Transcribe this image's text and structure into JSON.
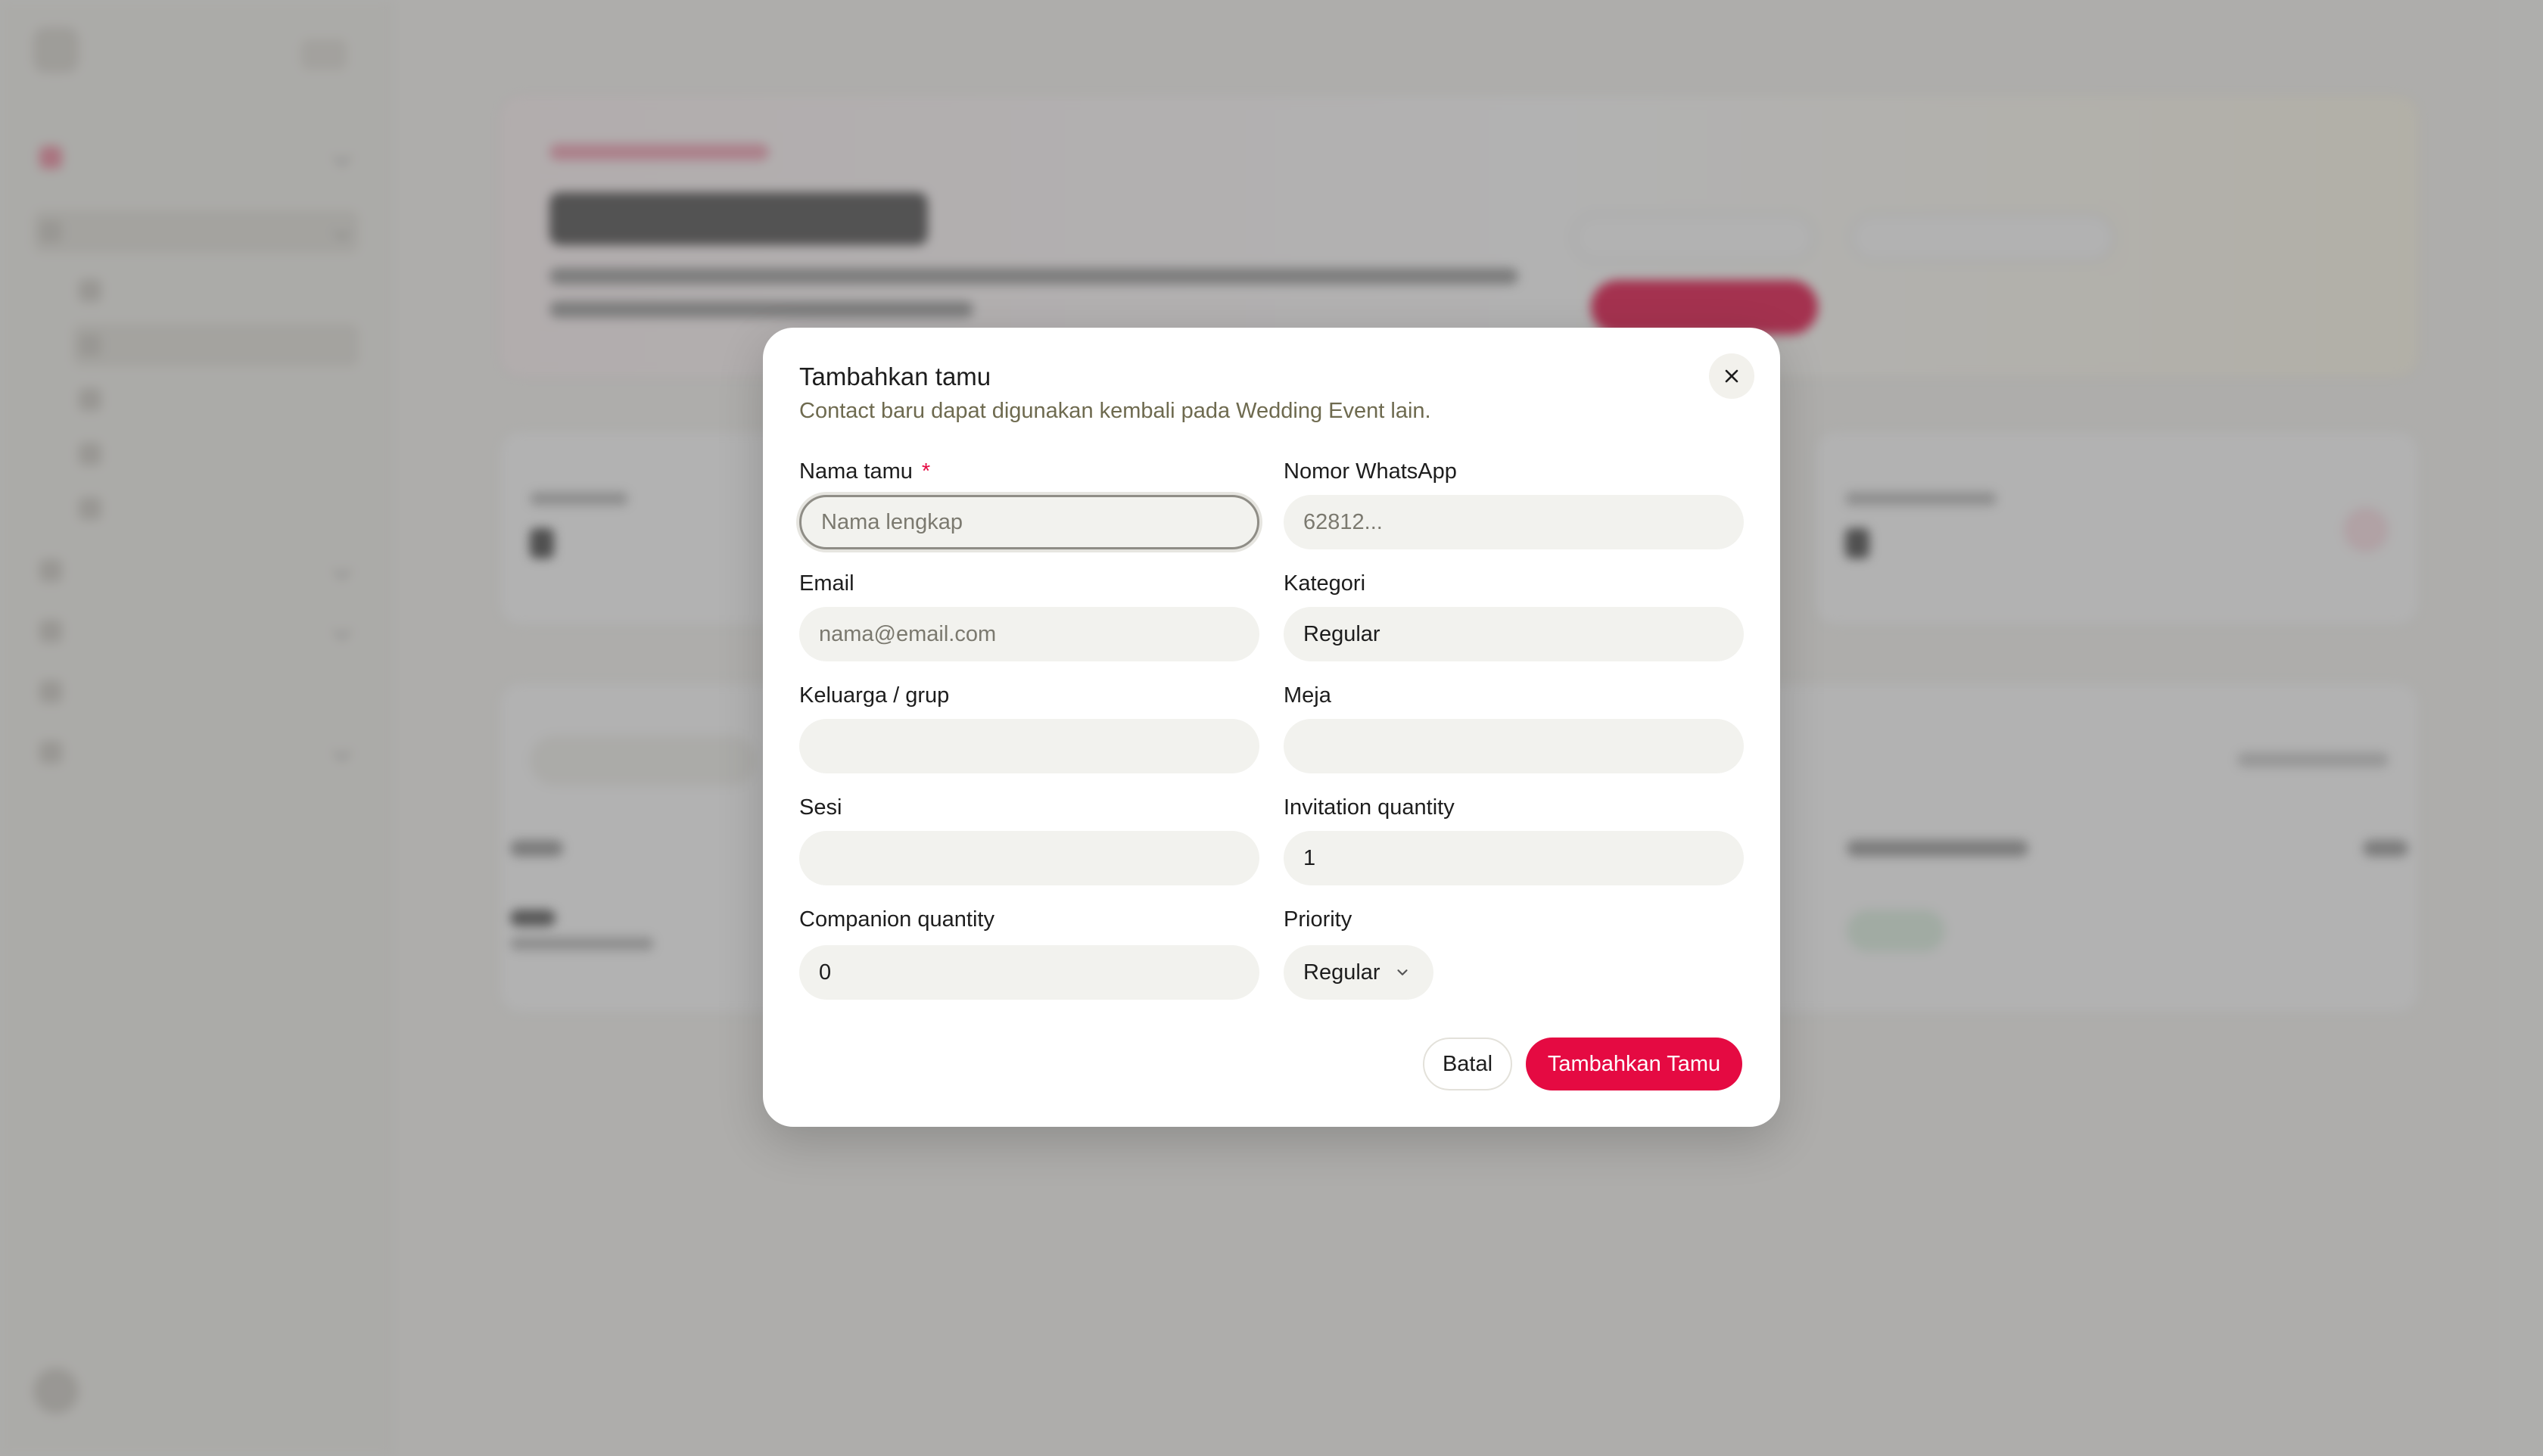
{
  "modal": {
    "title": "Tambahkan tamu",
    "description": "Contact baru dapat digunakan kembali pada Wedding Event lain.",
    "close_icon": "close-icon",
    "fields": {
      "name": {
        "label": "Nama tamu",
        "required_mark": "*",
        "placeholder": "Nama lengkap",
        "value": ""
      },
      "whatsapp": {
        "label": "Nomor WhatsApp",
        "placeholder": "62812...",
        "value": ""
      },
      "email": {
        "label": "Email",
        "placeholder": "nama@email.com",
        "value": ""
      },
      "category": {
        "label": "Kategori",
        "value": "Regular"
      },
      "family": {
        "label": "Keluarga / grup",
        "value": ""
      },
      "table": {
        "label": "Meja",
        "value": ""
      },
      "session": {
        "label": "Sesi",
        "value": ""
      },
      "invitation_quantity": {
        "label": "Invitation quantity",
        "value": "1"
      },
      "companion_quantity": {
        "label": "Companion quantity",
        "value": "0"
      },
      "priority": {
        "label": "Priority",
        "value": "Regular",
        "icon": "chevron-down-icon"
      }
    },
    "buttons": {
      "cancel": "Batal",
      "submit": "Tambahkan Tamu"
    }
  },
  "colors": {
    "accent": "#e50a42",
    "description_text": "#6e6a4f",
    "input_bg": "#f2f2ee",
    "overlay": "rgba(95,95,95,0.48)"
  }
}
